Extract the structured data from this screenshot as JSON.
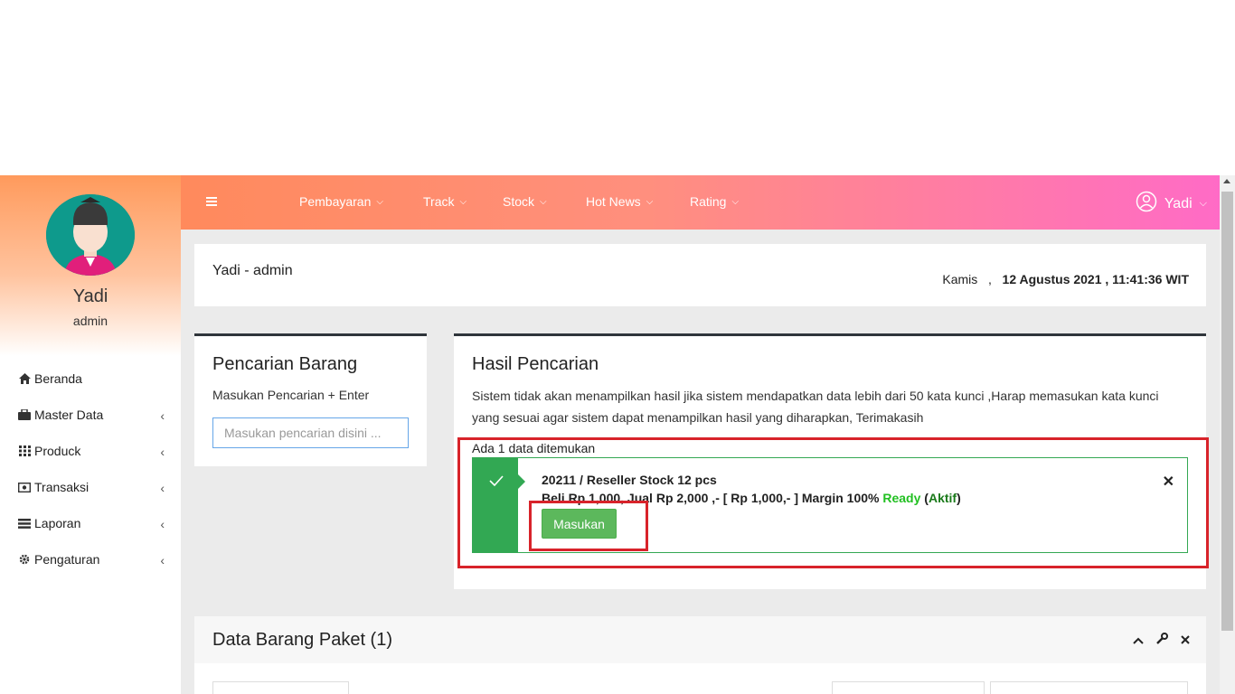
{
  "sidebar": {
    "user_name": "Yadi",
    "user_role": "admin",
    "items": [
      {
        "label": "Beranda",
        "icon": "home-icon",
        "has_children": false
      },
      {
        "label": "Master Data",
        "icon": "briefcase-icon",
        "has_children": true
      },
      {
        "label": "Producik",
        "icon": "grid-icon",
        "has_children": true
      },
      {
        "label": "Transaksi",
        "icon": "money-icon",
        "has_children": true
      },
      {
        "label": "Laporan",
        "icon": "list-icon",
        "has_children": true
      },
      {
        "label": "Pengaturan",
        "icon": "gear-icon",
        "has_children": true
      }
    ]
  },
  "topbar": {
    "nav": [
      {
        "label": "Pembayaran"
      },
      {
        "label": "Track"
      },
      {
        "label": "Stock"
      },
      {
        "label": "Hot News"
      },
      {
        "label": "Rating"
      }
    ],
    "user": "Yadi"
  },
  "header": {
    "title": "Yadi - admin",
    "day": "Kamis",
    "separator": ",",
    "datetime": "12 Agustus 2021 , 11:41:36 WIT"
  },
  "search_panel": {
    "title": "Pencarian Barang",
    "subtitle": "Masukan Pencarian + Enter",
    "placeholder": "Masukan pencarian disini ..."
  },
  "result_panel": {
    "title": "Hasil Pencarian",
    "description": "Sistem tidak akan menampilkan hasil jika sistem mendapatkan data lebih dari 50 kata kunci ,Harap memasukan kata kunci yang sesuai agar sistem dapat menampilkan hasil yang diharapkan, Terimakasih",
    "found": "Ada 1 data ditemukan",
    "item": {
      "title": "20211 / Reseller Stock 12 pcs",
      "detail": "Beli Rp 1,000, Jual Rp 2,000 ,- [ Rp 1,000,- ] Margin 100%",
      "ready": "Ready",
      "status_open": "(",
      "status": "Aktif",
      "status_close": ")",
      "button": "Masukan"
    }
  },
  "bottom_panel": {
    "title": "Data Barang Paket (1)"
  },
  "colors": {
    "accent_green": "#5cb85c",
    "highlight_red": "#d8232a",
    "topbar_start": "#ff8a5c",
    "topbar_end": "#ff6bc6"
  }
}
